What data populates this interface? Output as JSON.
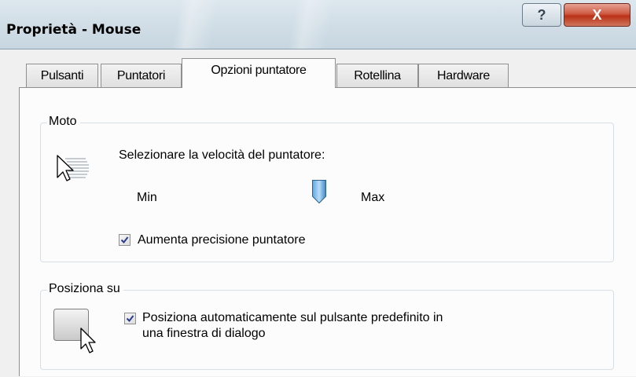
{
  "window": {
    "title": "Proprietà - Mouse",
    "help_label": "?",
    "close_label": "X",
    "accent_close": "#c83b1e"
  },
  "tabs": [
    {
      "label": "Pulsanti",
      "active": false
    },
    {
      "label": "Puntatori",
      "active": false
    },
    {
      "label": "Opzioni puntatore",
      "active": true
    },
    {
      "label": "Rotellina",
      "active": false
    },
    {
      "label": "Hardware",
      "active": false
    }
  ],
  "motion": {
    "group_label": "Moto",
    "speed_label": "Selezionare la velocità del puntatore:",
    "min_label": "Min",
    "max_label": "Max",
    "speed_value_fraction": 0.9,
    "tick_count": 11,
    "precision_checkbox": {
      "label": "Aumenta precisione puntatore",
      "checked": true
    },
    "icon": "pointer-speed-icon"
  },
  "snap_to": {
    "group_label": "Posiziona su",
    "checkbox": {
      "label_line1": "Posiziona automaticamente sul pulsante predefinito in",
      "label_line2": "una finestra di dialogo",
      "checked": true
    },
    "icon": "snap-to-button-icon"
  }
}
